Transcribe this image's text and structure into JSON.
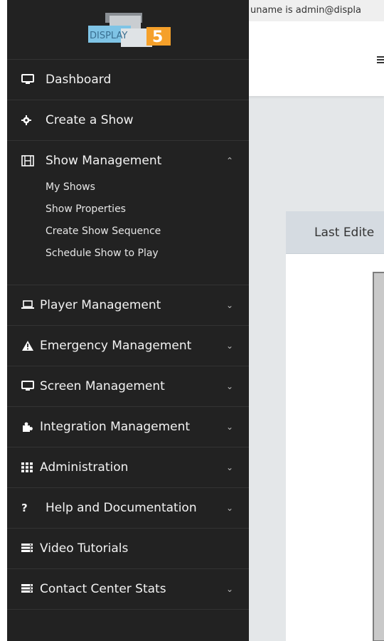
{
  "header": {
    "uname": "uname is admin@displa"
  },
  "logo": {
    "text": "DISPLAY",
    "badge": "5",
    "colors": {
      "blue": "#7fc4e6",
      "gray": "#b9bfc5",
      "orange": "#f5a02a"
    }
  },
  "sidebar": {
    "items": [
      {
        "label": "Dashboard",
        "icon": "monitor-icon"
      },
      {
        "label": "Create a Show",
        "icon": "gear-icon"
      },
      {
        "label": "Show Management",
        "icon": "film-icon",
        "expanded": true,
        "children": [
          "My Shows",
          "Show Properties",
          "Create Show Sequence",
          "Schedule Show to Play"
        ]
      },
      {
        "label": "Player Management",
        "icon": "laptop-icon"
      },
      {
        "label": "Emergency Management",
        "icon": "warning-icon"
      },
      {
        "label": "Screen Management",
        "icon": "monitor-icon"
      },
      {
        "label": "Integration Management",
        "icon": "puzzle-icon"
      },
      {
        "label": "Administration",
        "icon": "grid-icon"
      },
      {
        "label": "Help and Documentation",
        "icon": "question-icon"
      },
      {
        "label": "Video Tutorials",
        "icon": "list-icon"
      },
      {
        "label": "Contact Center Stats",
        "icon": "list-icon"
      }
    ]
  },
  "main": {
    "card_title": "Last Edite"
  },
  "colors": {
    "sidebar_bg": "#222222",
    "main_bg": "#e4e7e9",
    "card_header_bg": "#d5dbe1"
  }
}
